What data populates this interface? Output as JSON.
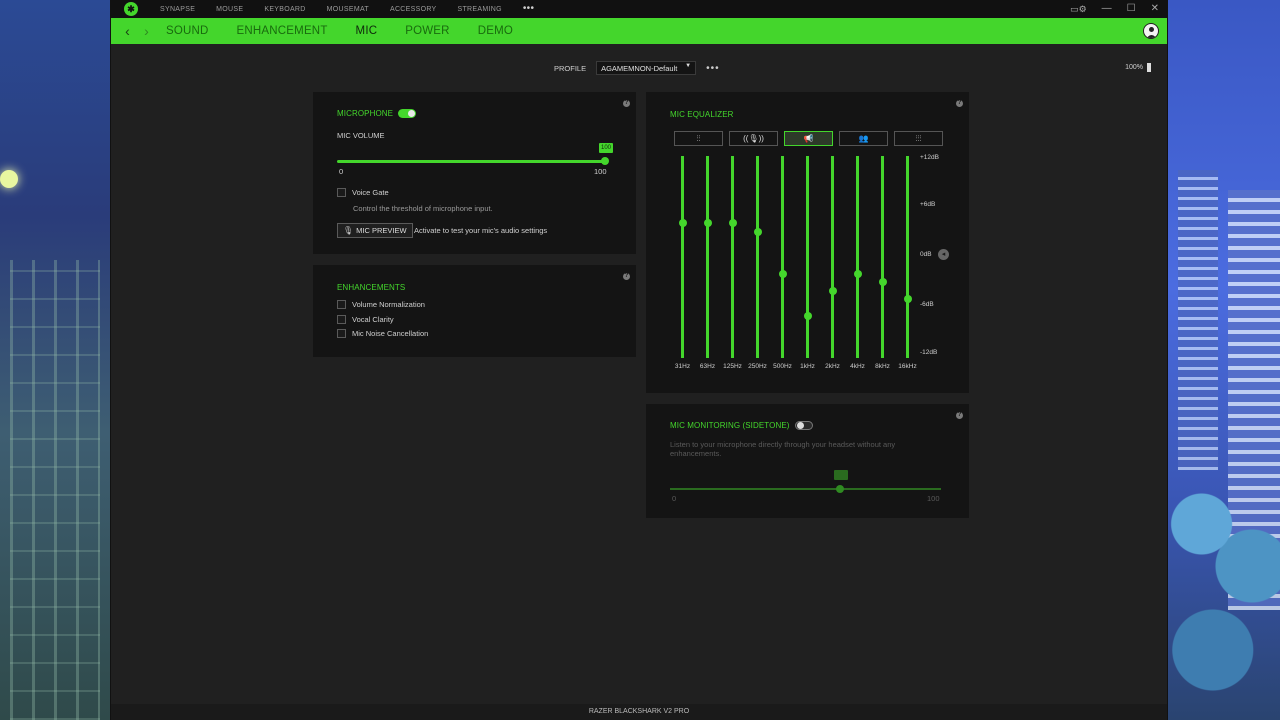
{
  "window": {
    "top_menu": [
      "SYNAPSE",
      "MOUSE",
      "KEYBOARD",
      "MOUSEMAT",
      "ACCESSORY",
      "STREAMING"
    ],
    "more_label": "•••"
  },
  "nav": {
    "tabs": [
      "SOUND",
      "ENHANCEMENT",
      "MIC",
      "POWER",
      "DEMO"
    ],
    "active_tab": "MIC"
  },
  "profile": {
    "label": "PROFILE",
    "selected": "AGAMEMNON-Default",
    "more": "•••"
  },
  "battery": {
    "percent_text": "100%"
  },
  "microphone": {
    "title": "MICROPHONE",
    "enabled": true,
    "volume_label": "MIC VOLUME",
    "volume_value": 100,
    "volume_badge": "100",
    "min_label": "0",
    "max_label": "100",
    "voice_gate_label": "Voice Gate",
    "voice_gate_desc": "Control the threshold of microphone input.",
    "preview_button": "MIC PREVIEW",
    "preview_desc": "Activate to test your mic's audio settings"
  },
  "enhancements": {
    "title": "ENHANCEMENTS",
    "items": [
      "Volume Normalization",
      "Vocal Clarity",
      "Mic Noise Cancellation"
    ]
  },
  "equalizer": {
    "title": "MIC EQUALIZER",
    "preset_icons": [
      "sliders-icon",
      "mic-broadcast-icon",
      "megaphone-icon",
      "people-icon",
      "custom-sliders-icon"
    ],
    "active_preset": 2,
    "db_labels": [
      "+12dB",
      "+6dB",
      "0dB",
      "-6dB",
      "-12dB"
    ],
    "bands": [
      {
        "freq": "31Hz",
        "db": 4
      },
      {
        "freq": "63Hz",
        "db": 4
      },
      {
        "freq": "125Hz",
        "db": 4
      },
      {
        "freq": "250Hz",
        "db": 3
      },
      {
        "freq": "500Hz",
        "db": -2
      },
      {
        "freq": "1kHz",
        "db": -7
      },
      {
        "freq": "2kHz",
        "db": -4
      },
      {
        "freq": "4kHz",
        "db": -2
      },
      {
        "freq": "8kHz",
        "db": -3
      },
      {
        "freq": "16kHz",
        "db": -5
      }
    ]
  },
  "sidetone": {
    "title": "MIC MONITORING (SIDETONE)",
    "enabled": false,
    "desc": "Listen to your microphone directly through your headset without any enhancements.",
    "value": 63,
    "min_label": "0",
    "max_label": "100"
  },
  "status": {
    "device_name": "RAZER BLACKSHARK V2 PRO"
  },
  "colors": {
    "accent": "#44d62c",
    "background": "#202020",
    "panel": "#141414"
  }
}
